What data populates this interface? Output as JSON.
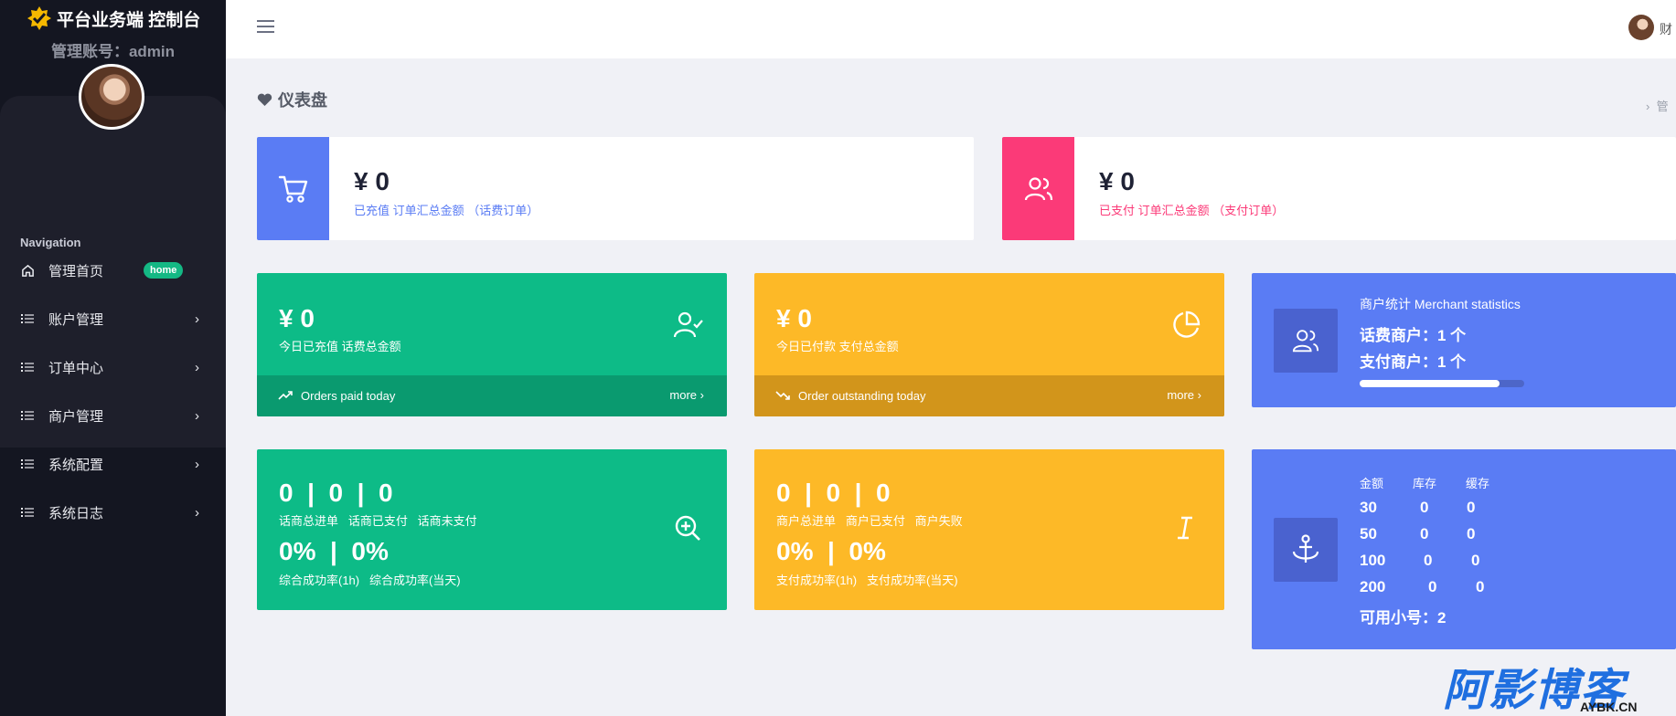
{
  "sidebar": {
    "brand_title": "平台业务端 控制台",
    "account_label": "管理账号：admin",
    "nav_title": "Navigation",
    "items": [
      {
        "label": "管理首页",
        "icon": "home-icon",
        "badge": "home"
      },
      {
        "label": "账户管理",
        "icon": "list-icon"
      },
      {
        "label": "订单中心",
        "icon": "list-icon"
      },
      {
        "label": "商户管理",
        "icon": "list-icon"
      },
      {
        "label": "系统配置",
        "icon": "list-icon"
      },
      {
        "label": "系统日志",
        "icon": "list-icon"
      }
    ]
  },
  "header": {
    "user_name": "财",
    "page_title": "仪表盘",
    "breadcrumb": "管"
  },
  "cards": {
    "recharged": {
      "amount": "¥ 0",
      "label": "已充值 订单汇总金额 （话费订单）",
      "color": "#5a7cf4"
    },
    "paid": {
      "amount": "¥ 0",
      "label": "已支付 订单汇总金额 （支付订单）",
      "color": "#fb3a78"
    },
    "today_recharge": {
      "amount": "¥ 0",
      "label": "今日已充值 话费总金额",
      "footer": "Orders paid today",
      "more": "more",
      "color": "#0dbb87"
    },
    "today_paid": {
      "amount": "¥ 0",
      "label": "今日已付款 支付总金额",
      "footer": "Order outstanding today",
      "more": "more",
      "color": "#fdb927"
    },
    "merchant": {
      "title": "商户统计 Merchant statistics",
      "phone_merchants": "话费商户：1 个",
      "pay_merchants": "支付商户：1 个",
      "progress": 0.85
    },
    "phone_orders": {
      "row1": "0  |  0  |  0",
      "row1_labels": "话商总进单   话商已支付   话商未支付",
      "row2": "0%  |  0%",
      "row2_labels": "综合成功率(1h)   综合成功率(当天)"
    },
    "merchant_orders": {
      "row1": "0  |  0  |  0",
      "row1_labels": "商户总进单   商户已支付   商户失败",
      "row2": "0%  |  0%",
      "row2_labels": "支付成功率(1h)   支付成功率(当天)"
    },
    "inventory": {
      "headers": [
        "金额",
        "库存",
        "缓存"
      ],
      "rows": [
        [
          "30",
          "0",
          "0"
        ],
        [
          "50",
          "0",
          "0"
        ],
        [
          "100",
          "0",
          "0"
        ],
        [
          "200",
          "0",
          "0"
        ]
      ],
      "available": "可用小号：2"
    }
  },
  "watermark": {
    "text": "阿影博客",
    "sub": "AYBK.CN"
  }
}
